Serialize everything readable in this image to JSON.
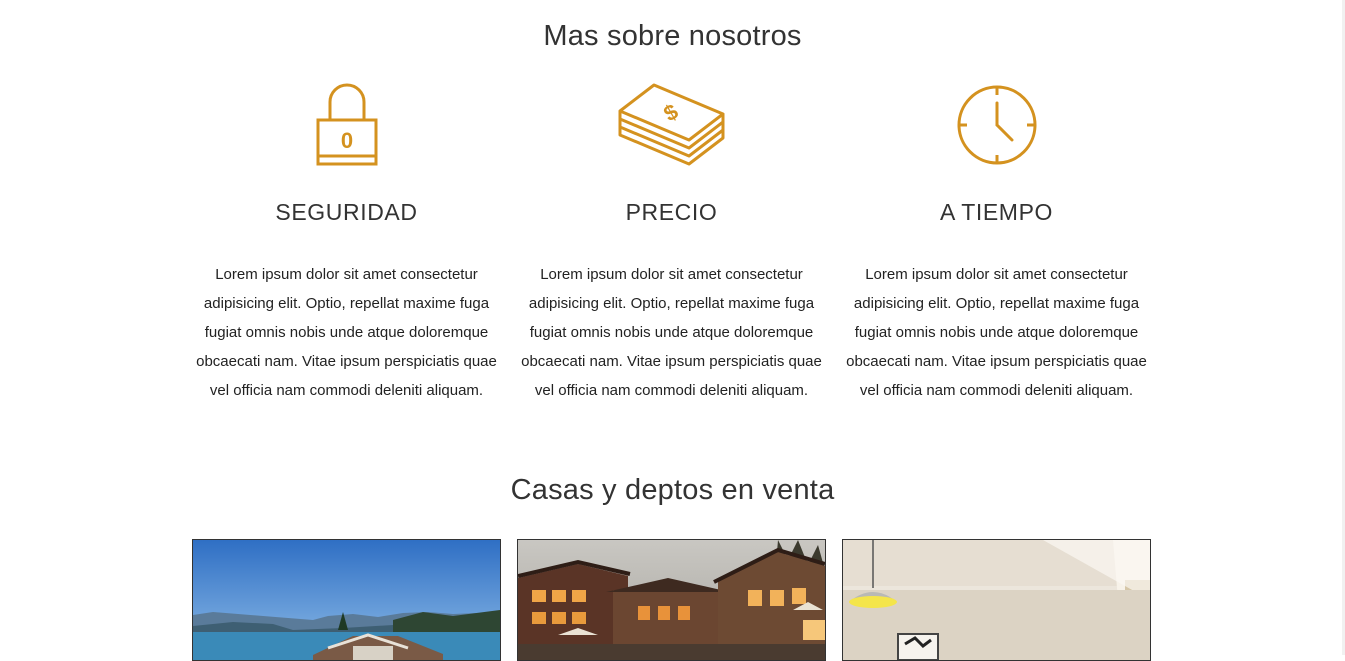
{
  "about": {
    "title": "Mas sobre nosotros",
    "features": [
      {
        "icon": "lock-icon",
        "lock_digit": "0",
        "heading": "SEGURIDAD",
        "text": "Lorem ipsum dolor sit amet consectetur adipisicing elit. Optio, repellat maxime fuga fugiat omnis nobis unde atque doloremque obcaecati nam. Vitae ipsum perspiciatis quae vel officia nam commodi deleniti aliquam."
      },
      {
        "icon": "money-stack-icon",
        "heading": "PRECIO",
        "text": "Lorem ipsum dolor sit amet consectetur adipisicing elit. Optio, repellat maxime fuga fugiat omnis nobis unde atque doloremque obcaecati nam. Vitae ipsum perspiciatis quae vel officia nam commodi deleniti aliquam."
      },
      {
        "icon": "clock-icon",
        "heading": "A TIEMPO",
        "text": "Lorem ipsum dolor sit amet consectetur adipisicing elit. Optio, repellat maxime fuga fugiat omnis nobis unde atque doloremque obcaecati nam. Vitae ipsum perspiciatis quae vel officia nam commodi deleniti aliquam."
      }
    ]
  },
  "listings": {
    "title": "Casas y deptos en venta",
    "cards": [
      {
        "image": "lakeside-house-photo"
      },
      {
        "image": "wooden-lodge-photo"
      },
      {
        "image": "interior-room-photo"
      }
    ]
  },
  "colors": {
    "accent": "#d4921f",
    "text": "#333333"
  }
}
